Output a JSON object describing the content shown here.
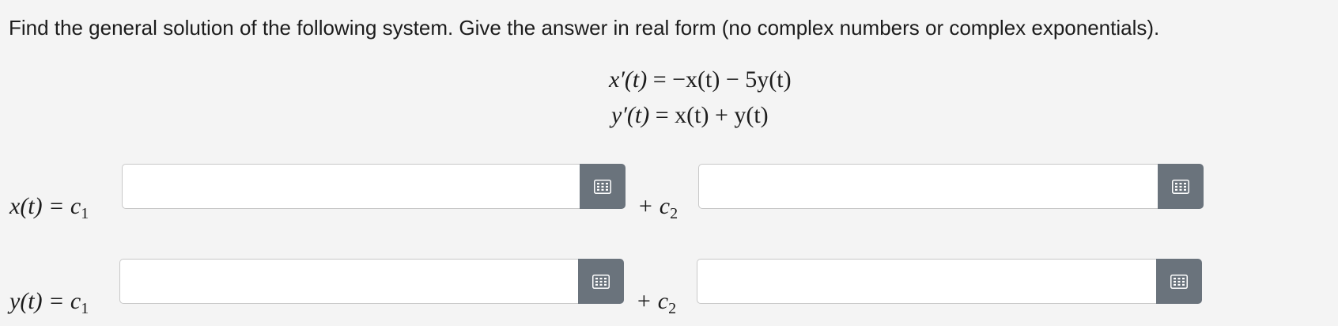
{
  "prompt": "Find the general solution of the following system. Give the answer in real form (no complex numbers or complex exponentials).",
  "system": {
    "eq1": {
      "lhs": "x′(t)",
      "rhs": "= −x(t) − 5y(t)"
    },
    "eq2": {
      "lhs": "y′(t)",
      "rhs": "= x(t) + y(t)"
    }
  },
  "rows": {
    "x": {
      "lhs": "x(t) = c",
      "sub": "1",
      "plus": "+ c",
      "plus_sub": "2"
    },
    "y": {
      "lhs": "y(t) = c",
      "sub": "1",
      "plus": "+ c",
      "plus_sub": "2"
    }
  },
  "inputs": {
    "x_c1_value": "",
    "x_c2_value": "",
    "y_c1_value": "",
    "y_c2_value": ""
  },
  "icons": {
    "keypad": "keypad-icon"
  },
  "colors": {
    "background": "#f4f4f4",
    "keypad_button": "#6a737c",
    "input_border": "#c8c8c8"
  }
}
